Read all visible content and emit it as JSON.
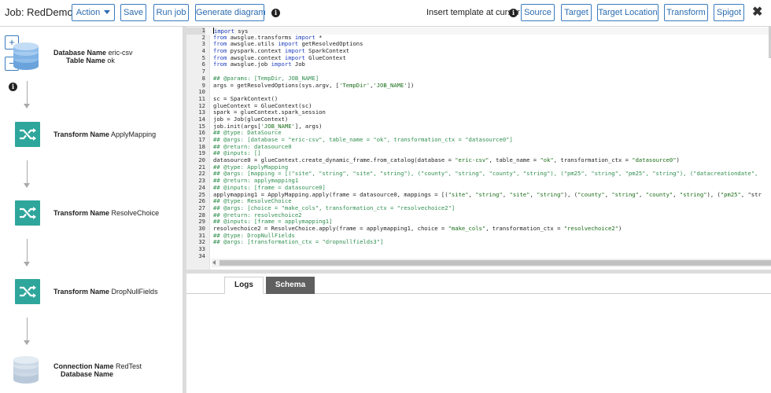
{
  "toolbar": {
    "job_title": "Job: RedDemo",
    "action_label": "Action",
    "save_label": "Save",
    "run_job_label": "Run job",
    "generate_diagram_label": "Generate diagram",
    "insert_template_label": "Insert template at cursor",
    "source_label": "Source",
    "target_label": "Target",
    "target_location_label": "Target Location",
    "transform_label": "Transform",
    "spigot_label": "Spigot",
    "close_label": "✖",
    "info_glyph": "i"
  },
  "diagram": {
    "zoom_in_label": "+",
    "zoom_out_label": "−",
    "nodes": [
      {
        "kind": "database",
        "icon": "database-icon",
        "key1": "Database Name",
        "val1": "eric-csv",
        "key2": "Table Name",
        "val2": "ok"
      },
      {
        "kind": "transform",
        "icon": "shuffle-icon",
        "key1": "Transform Name",
        "val1": "ApplyMapping"
      },
      {
        "kind": "transform",
        "icon": "shuffle-icon",
        "key1": "Transform Name",
        "val1": "ResolveChoice"
      },
      {
        "kind": "transform",
        "icon": "shuffle-icon",
        "key1": "Transform Name",
        "val1": "DropNullFields"
      },
      {
        "kind": "connection",
        "icon": "database-icon",
        "key1": "Connection Name",
        "val1": "RedTest",
        "key2": "Database Name",
        "val2": ""
      }
    ],
    "colors": {
      "transform": "#2fa69c",
      "database": "#7fb2e5",
      "connection": "#c5d3e2"
    }
  },
  "editor": {
    "lines": [
      {
        "n": "1",
        "t": "import sys"
      },
      {
        "n": "2",
        "t": "from awsglue.transforms import *"
      },
      {
        "n": "3",
        "t": "from awsglue.utils import getResolvedOptions"
      },
      {
        "n": "4",
        "t": "from pyspark.context import SparkContext"
      },
      {
        "n": "5",
        "t": "from awsglue.context import GlueContext"
      },
      {
        "n": "6",
        "t": "from awsglue.job import Job"
      },
      {
        "n": "7",
        "t": ""
      },
      {
        "n": "8",
        "t": "## @params: [TempDir, JOB_NAME]"
      },
      {
        "n": "9",
        "t": "args = getResolvedOptions(sys.argv, ['TempDir','JOB_NAME'])"
      },
      {
        "n": "10",
        "t": ""
      },
      {
        "n": "11",
        "t": "sc = SparkContext()"
      },
      {
        "n": "12",
        "t": "glueContext = GlueContext(sc)"
      },
      {
        "n": "13",
        "t": "spark = glueContext.spark_session"
      },
      {
        "n": "14",
        "t": "job = Job(glueContext)"
      },
      {
        "n": "15",
        "t": "job.init(args['JOB_NAME'], args)"
      },
      {
        "n": "16",
        "t": "## @type: DataSource"
      },
      {
        "n": "17",
        "t": "## @args: [database = \"eric-csv\", table_name = \"ok\", transformation_ctx = \"datasource0\"]"
      },
      {
        "n": "18",
        "t": "## @return: datasource0"
      },
      {
        "n": "19",
        "t": "## @inputs: []"
      },
      {
        "n": "20",
        "t": "datasource0 = glueContext.create_dynamic_frame.from_catalog(database = \"eric-csv\", table_name = \"ok\", transformation_ctx = \"datasource0\")"
      },
      {
        "n": "21",
        "t": "## @type: ApplyMapping"
      },
      {
        "n": "22",
        "t": "## @args: [mapping = [(\"site\", \"string\", \"site\", \"string\"), (\"county\", \"string\", \"county\", \"string\"), (\"pm25\", \"string\", \"pm25\", \"string\"), (\"datacreationdate\","
      },
      {
        "n": "23",
        "t": "## @return: applymapping1"
      },
      {
        "n": "24",
        "t": "## @inputs: [frame = datasource0]"
      },
      {
        "n": "25",
        "t": "applymapping1 = ApplyMapping.apply(frame = datasource0, mappings = [(\"site\", \"string\", \"site\", \"string\"), (\"county\", \"string\", \"county\", \"string\"), (\"pm25\", \"str"
      },
      {
        "n": "26",
        "t": "## @type: ResolveChoice"
      },
      {
        "n": "27",
        "t": "## @args: [choice = \"make_cols\", transformation_ctx = \"resolvechoice2\"]"
      },
      {
        "n": "28",
        "t": "## @return: resolvechoice2"
      },
      {
        "n": "29",
        "t": "## @inputs: [frame = applymapping1]"
      },
      {
        "n": "30",
        "t": "resolvechoice2 = ResolveChoice.apply(frame = applymapping1, choice = \"make_cols\", transformation_ctx = \"resolvechoice2\")"
      },
      {
        "n": "31",
        "t": "## @type: DropNullFields"
      },
      {
        "n": "32",
        "t": "## @args: [transformation_ctx = \"dropnullfields3\"]"
      },
      {
        "n": "33",
        "t": ""
      },
      {
        "n": "34",
        "t": ""
      }
    ]
  },
  "bottom": {
    "tabs": [
      {
        "label": "Logs",
        "active": true
      },
      {
        "label": "Schema",
        "active": false
      }
    ]
  }
}
